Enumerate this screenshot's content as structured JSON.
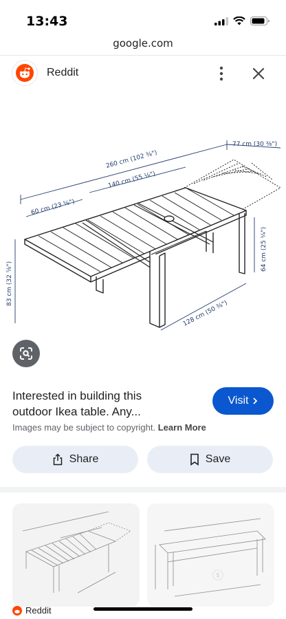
{
  "status_bar": {
    "time": "13:43"
  },
  "browser": {
    "url": "google.com"
  },
  "header": {
    "source_name": "Reddit"
  },
  "image": {
    "dimensions": {
      "total_length": "260 cm (102 ⅜\")",
      "middle_length": "140 cm (55 ⅛\")",
      "leaf_length": "60 cm (23 ⅝\")",
      "depth": "77 cm (30 ⅜\")",
      "overall_height": "83 cm (32 ⅝\")",
      "table_height": "64 cm (25 ¼\")",
      "leg_span": "128 cm (50 ⅜\")"
    }
  },
  "caption": {
    "title_line1": "Interested in building this",
    "title_line2": "outdoor Ikea table. Any...",
    "visit_label": "Visit",
    "copyright_text": "Images may be subject to copyright.",
    "learn_more": "Learn More"
  },
  "actions": {
    "share_label": "Share",
    "save_label": "Save"
  },
  "related": {
    "source_name": "Reddit"
  },
  "colors": {
    "accent": "#0b57d0",
    "chip_bg": "#e9eef6",
    "reddit_orange": "#ff4500"
  }
}
